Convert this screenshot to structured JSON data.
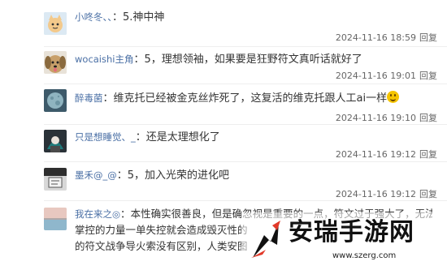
{
  "comments": [
    {
      "username": "小咚冬、、",
      "separator": "：",
      "text": "5.神中神",
      "timestamp": "2024-11-16 18:59",
      "reply_label": "回复"
    },
    {
      "username": "wocaishi主角",
      "separator": "：",
      "text": "5，理想领袖，如果要是狂野符文真听话就好了",
      "timestamp": "2024-11-16 19:01",
      "reply_label": "回复"
    },
    {
      "username": "醉毒菌",
      "separator": "：",
      "text": "维克托已经被金克丝炸死了，这复活的维克托跟人工ai一样",
      "timestamp": "2024-11-16 19:10",
      "reply_label": "回复"
    },
    {
      "username": "只是想睡觉、_",
      "separator": "：",
      "text": "还是太理想化了",
      "timestamp": "2024-11-16 19:12",
      "reply_label": "回复"
    },
    {
      "username": "墨禾@_@",
      "separator": "：",
      "text": "5，加入光荣的进化吧",
      "timestamp": "2024-11-16 19:12",
      "reply_label": "回复"
    },
    {
      "username": "我在来之◎",
      "separator": "：",
      "text_lines": [
        "本性确实很善良，但是确忽视是重要的一点，符文过于强大了，无法",
        "掌控的力量一单失控就会造成毁灭性的",
        "的符文战争导火索没有区别，人类安图"
      ]
    }
  ],
  "watermark": {
    "title": "安瑞手游网",
    "url": "www.szerg.com"
  },
  "colors": {
    "username": "#4a6fa5",
    "meta": "#666666"
  }
}
